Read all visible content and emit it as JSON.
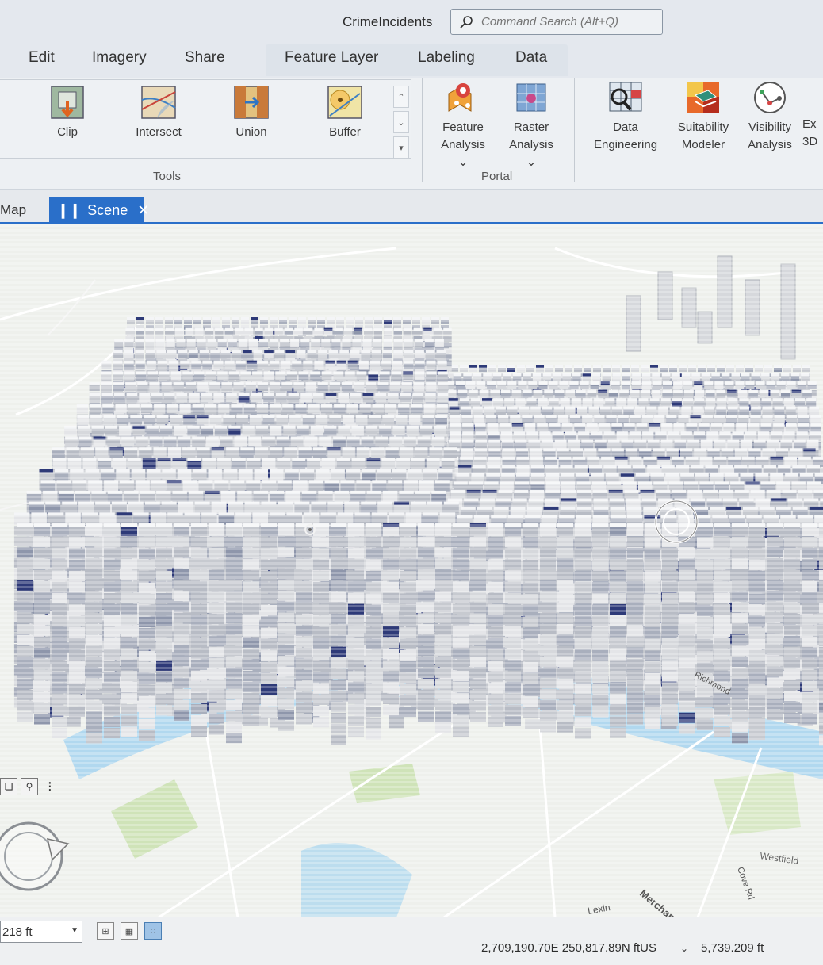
{
  "title_bar": {
    "app_title": "CrimeIncidents",
    "command_search_placeholder": "Command Search (Alt+Q)"
  },
  "tabs": {
    "edit": "Edit",
    "imagery": "Imagery",
    "share": "Share",
    "feature_layer": "Feature Layer",
    "labeling": "Labeling",
    "data": "Data"
  },
  "ribbon": {
    "tools": {
      "clip": "Clip",
      "intersect": "Intersect",
      "union": "Union",
      "buffer": "Buffer",
      "group_label": "Tools"
    },
    "portal": {
      "feature_analysis_1": "Feature",
      "feature_analysis_2": "Analysis",
      "raster_analysis_1": "Raster",
      "raster_analysis_2": "Analysis",
      "group_label": "Portal"
    },
    "other": {
      "data_engineering_1": "Data",
      "data_engineering_2": "Engineering",
      "suitability_modeler_1": "Suitability",
      "suitability_modeler_2": "Modeler",
      "visibility_analysis_1": "Visibility",
      "visibility_analysis_2": "Analysis",
      "explore_3d_1": "Ex",
      "explore_3d_2": "3D"
    }
  },
  "view_tabs": {
    "map": "Map",
    "scene": "Scene"
  },
  "scene": {
    "street_labels": [
      "Richmond",
      "Westfield",
      "Cove Rd",
      "Merchant",
      "Lexin"
    ]
  },
  "status_bar": {
    "scale": "218 ft",
    "coordinates": "2,709,190.70E 250,817.89N ftUS",
    "elevation": "5,739.209 ft"
  },
  "colors": {
    "accent": "#2a6fc9",
    "column_light": "#d6d8dc",
    "column_dark": "#2e3a78",
    "water": "#9fd0ee",
    "basemap": "#eef0ec"
  }
}
